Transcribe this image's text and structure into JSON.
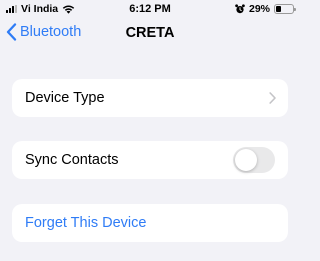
{
  "status_bar": {
    "carrier": "Vi India",
    "time": "6:12 PM",
    "battery_percent": "29%",
    "battery_level": 0.29
  },
  "nav": {
    "back_label": "Bluetooth",
    "title": "CRETA"
  },
  "settings": {
    "device_type_label": "Device Type",
    "sync_contacts_label": "Sync Contacts",
    "sync_contacts_enabled": false,
    "forget_label": "Forget This Device"
  },
  "colors": {
    "accent": "#2f7cf6",
    "background": "#f2f2f7",
    "toggle_off": "#e9e9ea"
  },
  "icons": {
    "back": "chevron-left-icon",
    "disclosure": "chevron-right-icon",
    "wifi": "wifi-icon",
    "signal": "signal-bars-icon",
    "alarm": "alarm-clock-icon",
    "battery": "battery-icon"
  }
}
